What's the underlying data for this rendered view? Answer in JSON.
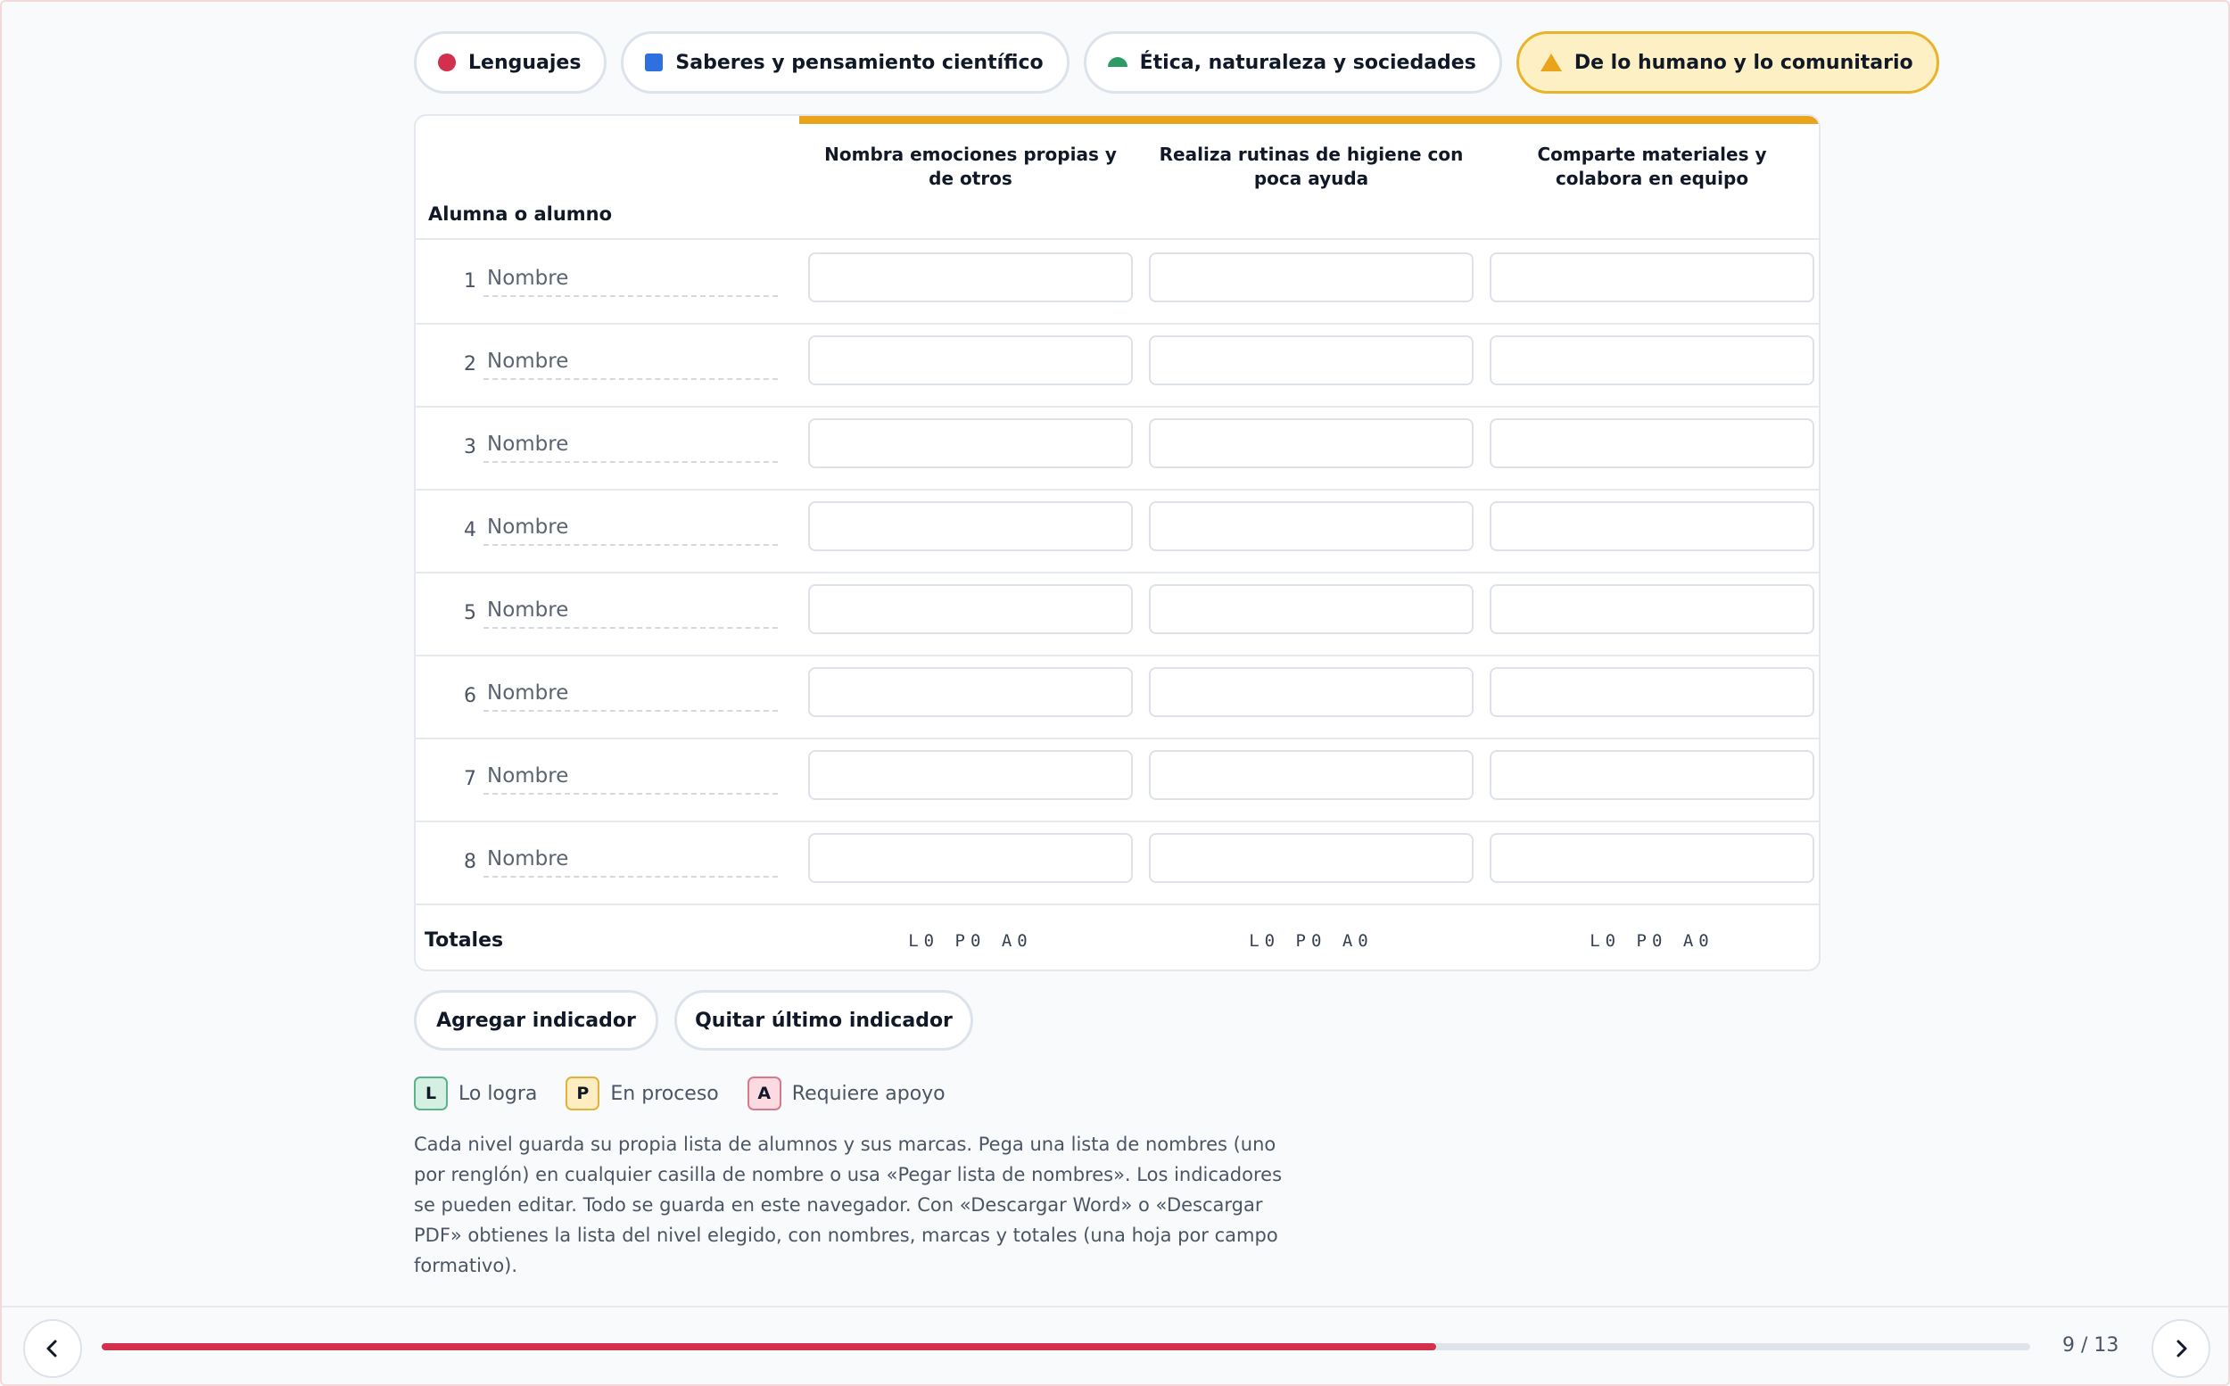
{
  "tabs": [
    {
      "label": "Lenguajes",
      "icon": "red-circle-icon",
      "color": "#d2304d"
    },
    {
      "label": "Saberes y pensamiento científico",
      "icon": "blue-square-icon",
      "color": "#2f6fde"
    },
    {
      "label": "Ética, naturaleza y sociedades",
      "icon": "green-dome-icon",
      "color": "#2e9a66"
    },
    {
      "label": "De lo humano y lo comunitario",
      "icon": "yellow-triangle-icon",
      "color": "#e9a41b",
      "active": true
    }
  ],
  "table": {
    "student_header": "Alumna o alumno",
    "indicators": [
      "Nombra emociones propias y de otros",
      "Realiza rutinas de higiene con poca ayuda",
      "Comparte materiales y colabora en equipo"
    ],
    "rows": [
      {
        "num": "1",
        "placeholder": "Nombre"
      },
      {
        "num": "2",
        "placeholder": "Nombre"
      },
      {
        "num": "3",
        "placeholder": "Nombre"
      },
      {
        "num": "4",
        "placeholder": "Nombre"
      },
      {
        "num": "5",
        "placeholder": "Nombre"
      },
      {
        "num": "6",
        "placeholder": "Nombre"
      },
      {
        "num": "7",
        "placeholder": "Nombre"
      },
      {
        "num": "8",
        "placeholder": "Nombre"
      }
    ],
    "totals_label": "Totales",
    "totals": [
      "L0 P0 A0",
      "L0 P0 A0",
      "L0 P0 A0"
    ]
  },
  "actions": {
    "add": "Agregar indicador",
    "remove": "Quitar último indicador"
  },
  "legend": [
    {
      "key": "L",
      "label": "Lo logra",
      "bg": "#d5efe3",
      "border": "#5bb38a"
    },
    {
      "key": "P",
      "label": "En proceso",
      "bg": "#fdedc0",
      "border": "#e3b23c"
    },
    {
      "key": "A",
      "label": "Requiere apoyo",
      "bg": "#fbdbe1",
      "border": "#d97a8c"
    }
  ],
  "note": "Cada nivel guarda su propia lista de alumnos y sus marcas. Pega una lista de nombres (uno por renglón) en cualquier casilla de nombre o usa «Pegar lista de nombres». Los indicadores se pueden editar. Todo se guarda en este navegador. Con «Descargar Word» o «Descargar PDF» obtienes la lista del nivel elegido, con nombres, marcas y totales (una hoja por campo formativo).",
  "footer": {
    "page_label": "9 / 13",
    "progress": 0.692,
    "accent_color": "#d2304d"
  }
}
